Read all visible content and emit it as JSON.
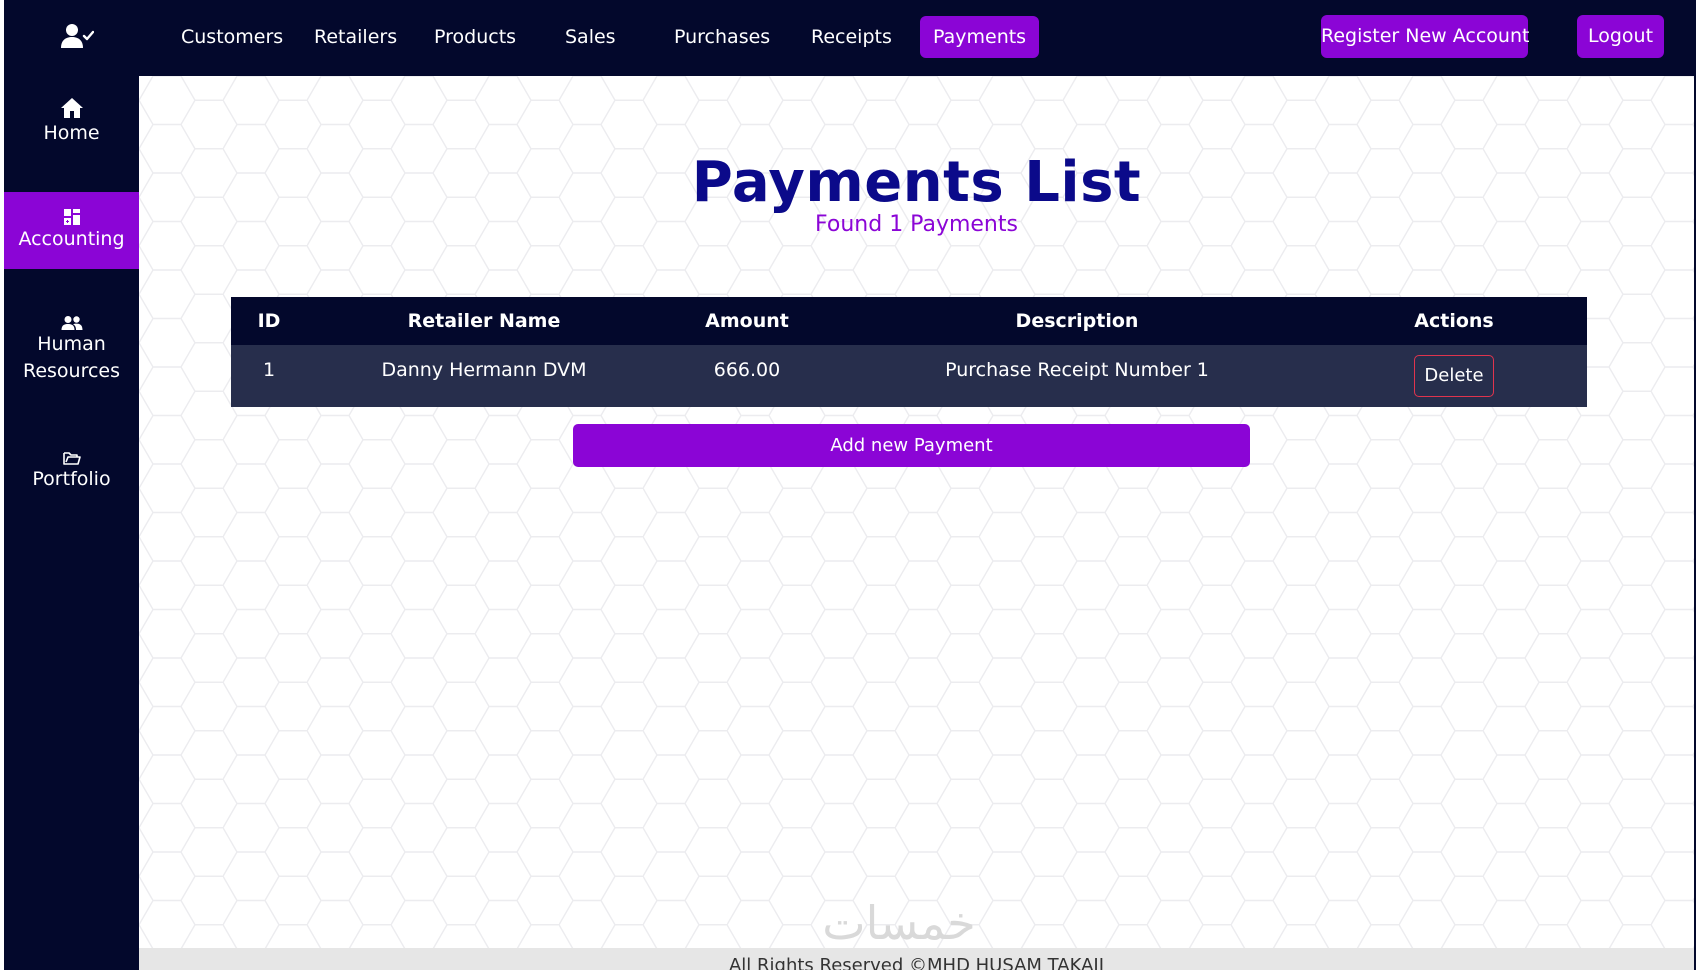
{
  "topnav": {
    "items": [
      {
        "label": "Customers"
      },
      {
        "label": "Retailers"
      },
      {
        "label": "Products"
      },
      {
        "label": "Sales"
      },
      {
        "label": "Purchases"
      },
      {
        "label": "Receipts"
      },
      {
        "label": "Payments",
        "active": true
      }
    ],
    "register_label": "Register New Account",
    "logout_label": "Logout"
  },
  "sidebar": {
    "items": [
      {
        "label": "Home",
        "icon": "home-icon"
      },
      {
        "label": "Accounting",
        "icon": "accounting-icon",
        "active": true
      },
      {
        "label_line1": "Human",
        "label_line2": "Resources",
        "icon": "users-icon"
      },
      {
        "label": "Portfolio",
        "icon": "folder-icon"
      }
    ]
  },
  "page": {
    "title": "Payments List",
    "subtitle": "Found 1 Payments"
  },
  "table": {
    "columns": [
      "ID",
      "Retailer Name",
      "Amount",
      "Description",
      "Actions"
    ],
    "rows": [
      {
        "id": "1",
        "retailer_name": "Danny Hermann DVM",
        "amount": "666.00",
        "description": "Purchase Receipt Number 1",
        "action_label": "Delete"
      }
    ]
  },
  "add_button_label": "Add new Payment",
  "watermark": "خمسات",
  "footer": {
    "text": "All Rights Reserved ©MHD HUSAM TAKAJI"
  },
  "colors": {
    "navy": "#03082c",
    "purple": "#8b05d6",
    "title_blue": "#0b0a8a",
    "row_bg": "#272e4c",
    "delete_border": "#e0344e"
  }
}
